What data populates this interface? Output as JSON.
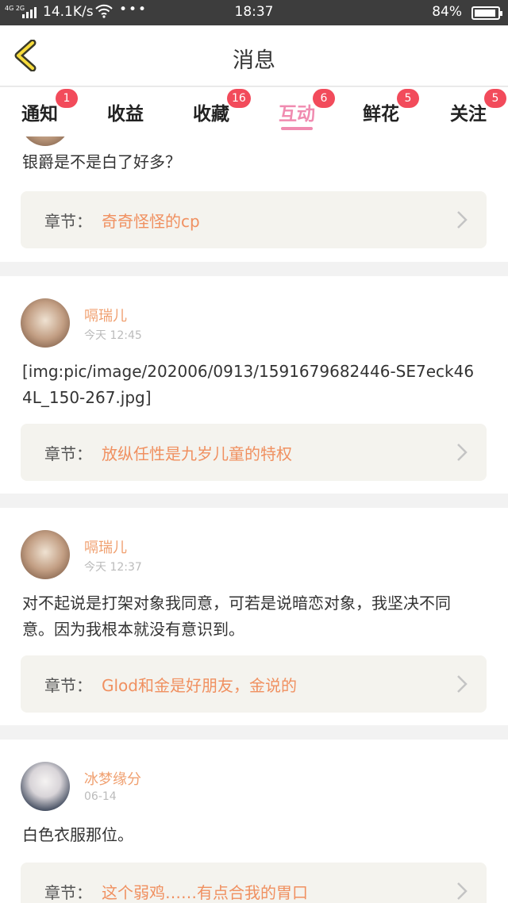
{
  "status": {
    "network": "4G 2G",
    "speed": "14.1K/s",
    "dots": "•••",
    "time": "18:37",
    "battery": "84%"
  },
  "header": {
    "title": "消息",
    "back_icon": "chevron-left-icon"
  },
  "tabs": [
    {
      "label": "通知",
      "badge": "1"
    },
    {
      "label": "收益",
      "badge": ""
    },
    {
      "label": "收藏",
      "badge": "16"
    },
    {
      "label": "互动",
      "badge": "6",
      "active": true
    },
    {
      "label": "鲜花",
      "badge": "5"
    },
    {
      "label": "关注",
      "badge": "5"
    }
  ],
  "accent_pink": "#f08bb0",
  "badge_red": "#f24b5b",
  "chapter_prefix": "章节：",
  "messages": [
    {
      "content": "银爵是不是白了好多？",
      "chapter": "奇奇怪怪的cp"
    },
    {
      "user": "嗝瑞儿",
      "time": "今天 12:45",
      "content": "[img:pic/image/202006/0913/1591679682446-SE7eck464L_150-267.jpg]",
      "chapter": "放纵任性是九岁儿童的特权"
    },
    {
      "user": "嗝瑞儿",
      "time": "今天 12:37",
      "content": "对不起说是打架对象我同意，可若是说暗恋对象，我坚决不同意。因为我根本就没有意识到。",
      "chapter": "Glod和金是好朋友，金说的"
    },
    {
      "user": "冰梦缘分",
      "time": "06-14",
      "content": "白色衣服那位。",
      "chapter": "这个弱鸡……有点合我的胃口"
    }
  ]
}
